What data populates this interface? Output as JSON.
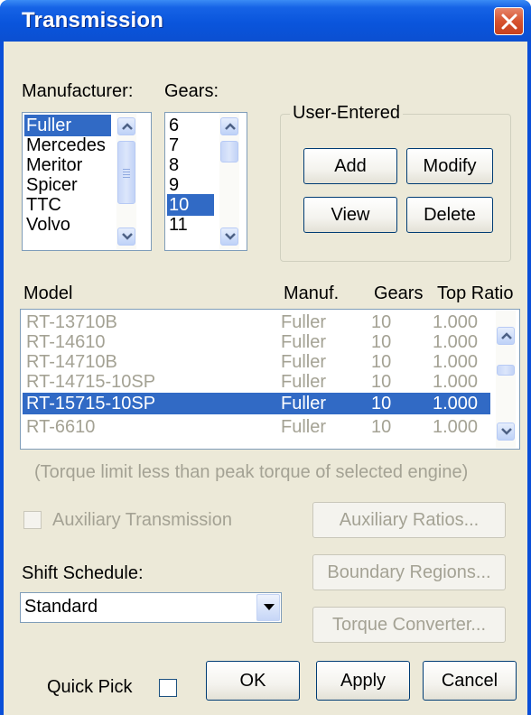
{
  "window": {
    "title": "Transmission"
  },
  "manufacturer": {
    "label": "Manufacturer:",
    "items": [
      "Fuller",
      "Mercedes",
      "Meritor",
      "Spicer",
      "TTC",
      "Volvo"
    ],
    "selected": "Fuller"
  },
  "gears": {
    "label": "Gears:",
    "items": [
      "6",
      "7",
      "8",
      "9",
      "10",
      "11"
    ],
    "selected": "10"
  },
  "user_entered": {
    "legend": "User-Entered",
    "add": "Add",
    "modify": "Modify",
    "view": "View",
    "delete": "Delete"
  },
  "models": {
    "headers": {
      "model": "Model",
      "manuf": "Manuf.",
      "gears": "Gears",
      "ratio": "Top Ratio"
    },
    "rows": [
      {
        "model": "RT-13710B",
        "manuf": "Fuller",
        "gears": "10",
        "ratio": "1.000"
      },
      {
        "model": "RT-14610",
        "manuf": "Fuller",
        "gears": "10",
        "ratio": "1.000"
      },
      {
        "model": "RT-14710B",
        "manuf": "Fuller",
        "gears": "10",
        "ratio": "1.000"
      },
      {
        "model": "RT-14715-10SP",
        "manuf": "Fuller",
        "gears": "10",
        "ratio": "1.000"
      },
      {
        "model": "RT-15715-10SP",
        "manuf": "Fuller",
        "gears": "10",
        "ratio": "1.000"
      },
      {
        "model": "RT-6610",
        "manuf": "Fuller",
        "gears": "10",
        "ratio": "1.000"
      }
    ],
    "selected_index": 4,
    "note": "(Torque limit less than peak torque of selected engine)"
  },
  "auxiliary": {
    "checkbox_label": "Auxiliary Transmission",
    "checked": false,
    "ratios_button": "Auxiliary Ratios..."
  },
  "shift_schedule": {
    "label": "Shift Schedule:",
    "value": "Standard"
  },
  "boundary_button": "Boundary Regions...",
  "torque_button": "Torque Converter...",
  "quick_pick": {
    "label": "Quick Pick",
    "checked": false
  },
  "footer": {
    "ok": "OK",
    "apply": "Apply",
    "cancel": "Cancel"
  },
  "colors": {
    "titlebar": "#0a55dc",
    "selection": "#316ac5",
    "face": "#ece9d8",
    "close": "#d6532f"
  }
}
